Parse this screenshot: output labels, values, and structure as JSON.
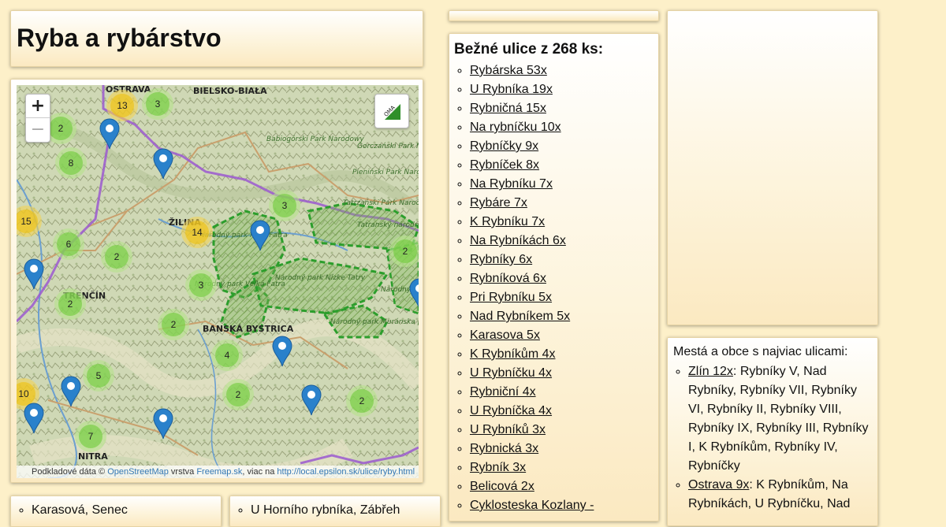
{
  "page": {
    "title": "Ryba a rybárstvo"
  },
  "map": {
    "zoom_in": "+",
    "zoom_out": "−",
    "layer_button": "OMA",
    "attribution": {
      "prefix": "Podkladové dáta ©",
      "osm": "OpenStreetMap",
      "layer_word": "vrstva",
      "freemap": "Freemap.sk",
      "more": ", viac na",
      "url": "http://local.epsilon.sk/ulice/ryby.html"
    },
    "place_labels": {
      "bielsko": "BIELSKO-BIAŁA",
      "ostrava": "OSTRAVA",
      "zilina": "ŽILINA",
      "trencin": "TRENČÍN",
      "banska": "BANSKÁ BYSTRICA",
      "nitra": "NITRA",
      "babiogorski": "Babiogórski Park Narodowy",
      "gorczanski": "Gorczański Park Narodowy",
      "pieninski": "Pieniński Park Narodowy",
      "tatrzanski": "Tatrzański Park Narodowy",
      "tatransky": "Tatranský národný park",
      "mala_fatra": "Národný park Malá Fatra",
      "velka_fatra": "Národný park Veľká Fatra",
      "nizke_tatry": "Národný park Nízke Tatry",
      "muranska": "Národný park Muránska planina",
      "slovensky_raj": "Národný park Slovenský raj"
    },
    "clusters": [
      {
        "count": "13",
        "color": "yellow"
      },
      {
        "count": "3",
        "color": "green"
      },
      {
        "count": "2",
        "color": "green"
      },
      {
        "count": "8",
        "color": "green"
      },
      {
        "count": "15",
        "color": "yellow"
      },
      {
        "count": "14",
        "color": "yellow"
      },
      {
        "count": "3",
        "color": "green"
      },
      {
        "count": "2",
        "color": "green"
      },
      {
        "count": "6",
        "color": "green"
      },
      {
        "count": "2",
        "color": "green"
      },
      {
        "count": "3",
        "color": "green"
      },
      {
        "count": "2",
        "color": "green"
      },
      {
        "count": "2",
        "color": "green"
      },
      {
        "count": "4",
        "color": "green"
      },
      {
        "count": "5",
        "color": "green"
      },
      {
        "count": "10",
        "color": "yellow"
      },
      {
        "count": "2",
        "color": "green"
      },
      {
        "count": "2",
        "color": "green"
      },
      {
        "count": "7",
        "color": "green"
      }
    ]
  },
  "streets": {
    "header": "Bežné ulice z 268 ks:",
    "items": [
      "Rybárska 53x",
      "U Rybníka 19x",
      "Rybničná 15x",
      "Na rybníčku 10x",
      "Rybníčky 9x",
      "Rybníček 8x",
      "Na Rybníku 7x",
      "Rybáre 7x",
      "K Rybníku 7x",
      "Na Rybníkách 6x",
      "Rybníky 6x",
      "Rybníková 6x",
      "Pri Rybníku 5x",
      "Nad Rybníkem 5x",
      "Karasova 5x",
      "K Rybníkům 4x",
      "U Rybníčku 4x",
      "Rybniční 4x",
      "U Rybníčka 4x",
      "U Rybníků 3x",
      "Rybnická 3x",
      "Rybník 3x",
      "Belicová 2x",
      "Cyklosteska Kozlany -"
    ]
  },
  "towns": {
    "header": "Mestá a obce s najviac ulicami:",
    "items": [
      {
        "link": "Zlín 12x",
        "rest": ": Rybníky V, Nad Rybníky, Rybníky VII, Rybníky VI, Rybníky II, Rybníky VIII, Rybníky IX, Rybníky III, Rybníky I, K Rybníkům, Rybníky IV, Rybníčky"
      },
      {
        "link": "Ostrava 9x",
        "rest": ": K Rybníkům, Na Rybníkách, U Rybníčku, Nad"
      }
    ]
  },
  "bottom": {
    "left_item": "Karasová, Senec",
    "right_item": "U Horního rybníka, Zábřeh"
  },
  "colors": {
    "background": "#fdf0c9",
    "cluster_green": "#6ecc39",
    "cluster_yellow": "#f0c20c",
    "marker_blue": "#2a81cb",
    "national_park_green": "#2c9e2c",
    "border_purple": "#9b59d0"
  }
}
